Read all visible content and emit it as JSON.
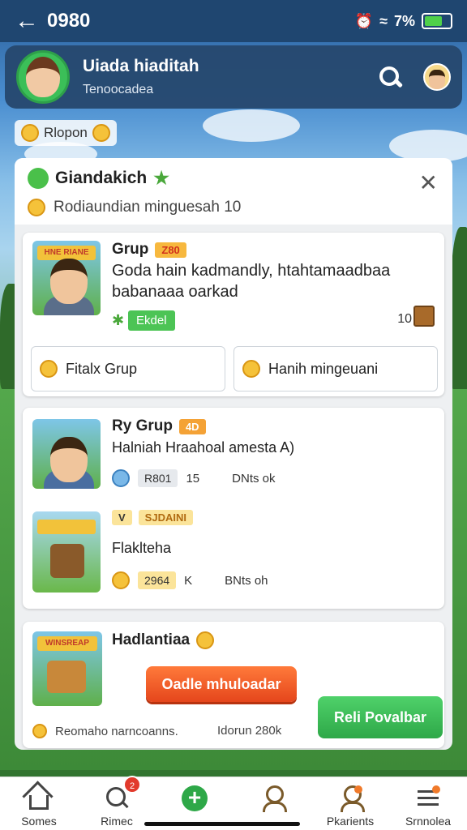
{
  "status_bar": {
    "time": "0980",
    "battery": "7%",
    "battery_level": 0.7
  },
  "header": {
    "name": "Uiada hiaditah",
    "subtitle": "Tenoocadea"
  },
  "chip": {
    "label": "Rlopon"
  },
  "panel": {
    "title": "Giandakich",
    "subtitle": "Rodiaundian minguesah 10"
  },
  "card1": {
    "thumb_banner": "HNE RIANE",
    "title": "Grup",
    "title_tag": "Z80",
    "body_line1": "Goda hain kadmandly, htahtamaadbaa",
    "body_line2": "babanaaa oarkad",
    "badge": "Ekdel",
    "count": "10",
    "button_left": "Fitalx Grup",
    "button_right": "Hanih mingeuani"
  },
  "card2": {
    "title": "Ry Grup",
    "title_tag": "4D",
    "body": "Halniah Hraahoal amesta A)",
    "stat_pill": "R801",
    "stat_num": "15",
    "stat_label": "DNts ok",
    "item2_tag_small": "V",
    "item2_tag": "SJDAINI",
    "item2_title": "Flaklteha",
    "item2_pill": "2964",
    "item2_num": "K",
    "item2_label": "BNts oh"
  },
  "card3": {
    "thumb_banner": "WINSREAP",
    "title": "Hadlantiaa",
    "cta_orange": "Oadle mhuloadar",
    "cta_green": "Reli Povalbar",
    "footer_left": "Reomaho narncoanns.",
    "footer_right": "Idorun 280k"
  },
  "navbar": {
    "items": [
      {
        "label": "Somes"
      },
      {
        "label": "Rimec"
      },
      {
        "label": ""
      },
      {
        "label": ""
      },
      {
        "label": "Pkarients"
      },
      {
        "label": "Srnnolea"
      }
    ],
    "badge_count": "2"
  },
  "colors": {
    "accent_green": "#2ea848",
    "accent_orange": "#e5461c",
    "header_bg": "#26486e"
  }
}
